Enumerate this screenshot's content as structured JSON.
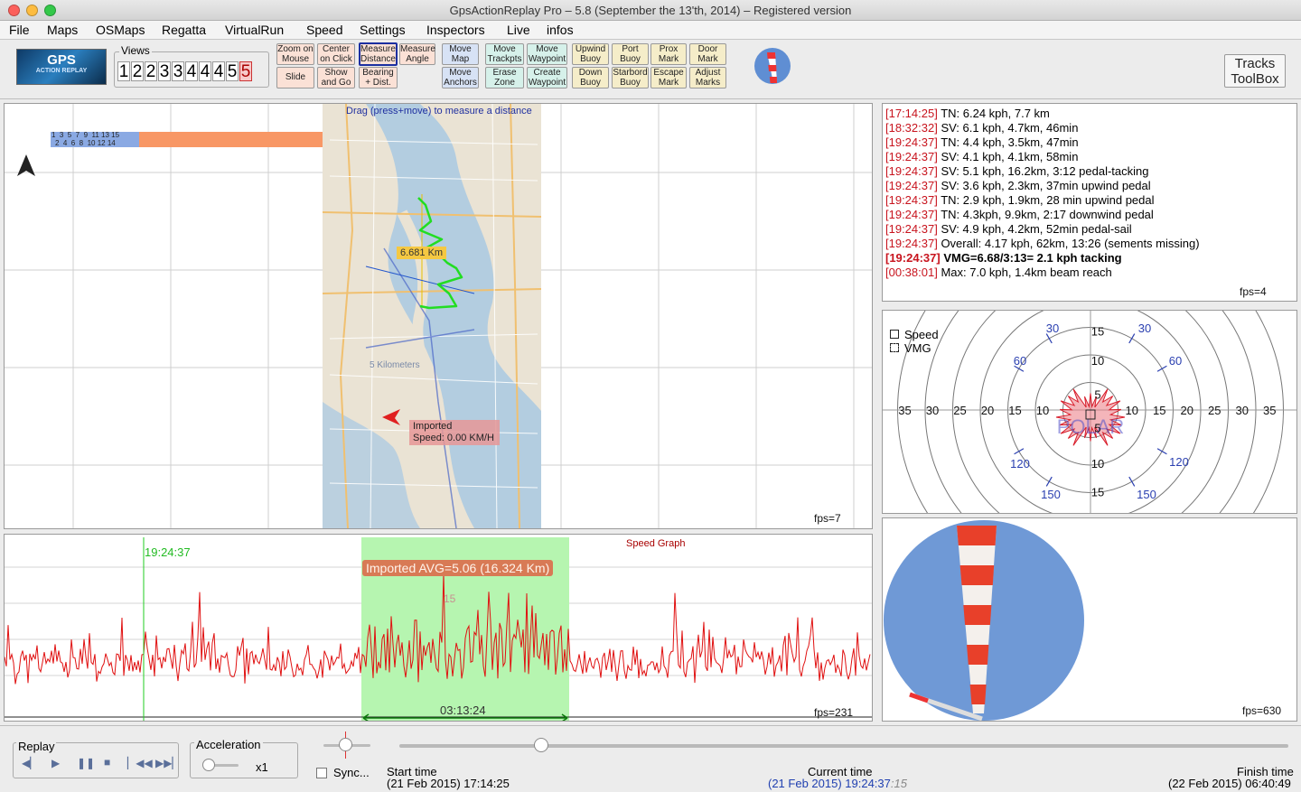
{
  "window": {
    "title": "GpsActionReplay Pro – 5.8  (September the 13'th, 2014)  –  Registered version"
  },
  "menu": [
    "File",
    "Maps",
    "OSMaps",
    "Regatta",
    "VirtualRun",
    "Speed",
    "Settings",
    "Inspectors",
    "Live",
    "infos"
  ],
  "toolbar": {
    "logo_text": "GPS",
    "logo_sub": "ACTION REPLAY",
    "views_label": "Views",
    "views": [
      "1",
      "2",
      "2",
      "3",
      "3",
      "4",
      "4",
      "4",
      "5",
      "5"
    ],
    "buttons": [
      {
        "l1": "Zoom on",
        "l2": "Mouse"
      },
      {
        "l1": "Center",
        "l2": "on Click"
      },
      {
        "l1": "Measure",
        "l2": "Distance"
      },
      {
        "l1": "Measure",
        "l2": "Angle"
      },
      {
        "l1": "Slide",
        "l2": ""
      },
      {
        "l1": "Show",
        "l2": "and Go"
      },
      {
        "l1": "Bearing",
        "l2": "+ Dist."
      },
      {
        "l1": "Move",
        "l2": "Map"
      },
      {
        "l1": "Move",
        "l2": "Anchors"
      },
      {
        "l1": "Move",
        "l2": "Trackpts"
      },
      {
        "l1": "Move",
        "l2": "Waypoint"
      },
      {
        "l1": "Erase",
        "l2": "Zone"
      },
      {
        "l1": "Create",
        "l2": "Waypoint"
      },
      {
        "l1": "Upwind",
        "l2": "Buoy"
      },
      {
        "l1": "Port",
        "l2": "Buoy"
      },
      {
        "l1": "Prox",
        "l2": "Mark"
      },
      {
        "l1": "Door",
        "l2": "Mark"
      },
      {
        "l1": "Down",
        "l2": "Buoy"
      },
      {
        "l1": "Starbord",
        "l2": "Buoy"
      },
      {
        "l1": "Escape",
        "l2": "Mark"
      },
      {
        "l1": "Adjust",
        "l2": "Marks"
      }
    ],
    "tracks_toolbox": {
      "l1": "Tracks",
      "l2": "ToolBox"
    }
  },
  "map": {
    "hint": "Drag (press+move) to measure a distance",
    "distance_label": "6.681 Km",
    "scale_text": "5 Kilometers",
    "track_popup": {
      "line1": "Imported",
      "line2": "Speed: 0.00 KM/H"
    },
    "timeline_top": "1  3  5  7  9  11 13 15",
    "timeline_bottom": "2  4  6  8  10 12 14",
    "fps": "fps=7"
  },
  "speed_graph": {
    "title": "Speed Graph",
    "cursor_time": "19:24:37",
    "avg_label": "Imported AVG=5.06 (16.324 Km)",
    "duration": "03:13:24",
    "y_tick": "15",
    "fps": "fps=231"
  },
  "log": {
    "entries": [
      {
        "time": "[17:14:25]",
        "text": " TN: 6.24 kph, 7.7 km",
        "bold": false
      },
      {
        "time": "[18:32:32]",
        "text": " SV: 6.1 kph, 4.7km, 46min",
        "bold": false
      },
      {
        "time": "[19:24:37]",
        "text": " TN: 4.4 kph, 3.5km, 47min",
        "bold": false
      },
      {
        "time": "[19:24:37]",
        "text": " SV: 4.1 kph, 4.1km, 58min",
        "bold": false
      },
      {
        "time": "[19:24:37]",
        "text": " SV: 5.1 kph, 16.2km, 3:12 pedal-tacking",
        "bold": false
      },
      {
        "time": "[19:24:37]",
        "text": " SV: 3.6 kph, 2.3km, 37min upwind pedal",
        "bold": false
      },
      {
        "time": "[19:24:37]",
        "text": " TN: 2.9 kph, 1.9km, 28 min upwind pedal",
        "bold": false
      },
      {
        "time": "[19:24:37]",
        "text": " TN: 4.3kph, 9.9km, 2:17 downwind pedal",
        "bold": false
      },
      {
        "time": "[19:24:37]",
        "text": " SV: 4.9 kph, 4.2km, 52min pedal-sail",
        "bold": false
      },
      {
        "time": "[19:24:37]",
        "text": " Overall: 4.17 kph, 62km, 13:26 (sements missing)",
        "bold": false
      },
      {
        "time": "[19:24:37]",
        "text": " VMG=6.68/3:13= 2.1 kph tacking",
        "bold": true
      },
      {
        "time": "[00:38:01]",
        "text": " Max: 7.0 kph, 1.4km beam reach",
        "bold": false
      }
    ],
    "fps": "fps=4"
  },
  "polar": {
    "legend": [
      "Speed",
      "VMG"
    ],
    "watermark": "POLAR",
    "x_ticks_left": [
      "35",
      "30",
      "25",
      "20",
      "15",
      "10"
    ],
    "x_ticks_right": [
      "10",
      "15",
      "20",
      "25",
      "30",
      "35"
    ],
    "y_ticks": [
      "15",
      "10",
      "5",
      "5",
      "10",
      "15"
    ],
    "angles": [
      "30",
      "30",
      "60",
      "60",
      "120",
      "120",
      "150",
      "150"
    ]
  },
  "windsock": {
    "fps": "fps=630"
  },
  "replay": {
    "label": "Replay",
    "acceleration_label": "Acceleration",
    "acceleration_value": "x1",
    "sync_label": "Sync...",
    "progress": 0.16,
    "start_label": "Start time",
    "start_value": "(21 Feb 2015) 17:14:25",
    "current_label": "Current time",
    "current_value": "(21 Feb 2015) 19:24:37",
    "current_suffix": ":15",
    "finish_label": "Finish time",
    "finish_value": "(22 Feb 2015) 06:40:49"
  },
  "colors": {
    "track_green": "#22dd22",
    "speed_red": "#e01010",
    "selection_green": "#b6f5b0",
    "log_timestamp": "#c8141e"
  }
}
